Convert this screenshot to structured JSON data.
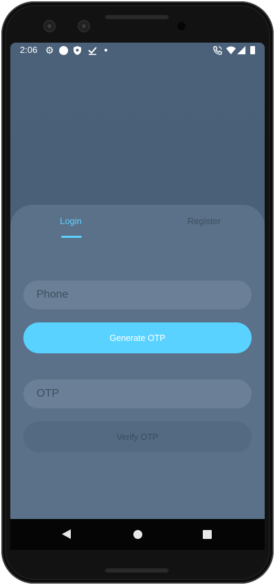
{
  "status_bar": {
    "time": "2:06",
    "icons": [
      "settings-icon",
      "circle-icon",
      "shield-icon",
      "check-download-icon",
      "dot-icon",
      "wifi-calling-icon",
      "wifi-icon",
      "signal-icon",
      "battery-icon"
    ]
  },
  "tabs": [
    {
      "label": "Login",
      "selected": true
    },
    {
      "label": "Register",
      "selected": false
    }
  ],
  "login_form": {
    "phone_placeholder": "Phone",
    "phone_value": "",
    "generate_button": "Generate OTP",
    "otp_placeholder": "OTP",
    "otp_value": "",
    "verify_button": "Verify OTP"
  },
  "nav_bar": {
    "buttons": [
      "back-icon",
      "home-icon",
      "recents-icon"
    ]
  },
  "colors": {
    "accent": "#5ad2ff",
    "screen_background": "#4a6078",
    "card_background": "#5a7189",
    "field_background": "#6b8096",
    "disabled_button": "#536a82"
  }
}
